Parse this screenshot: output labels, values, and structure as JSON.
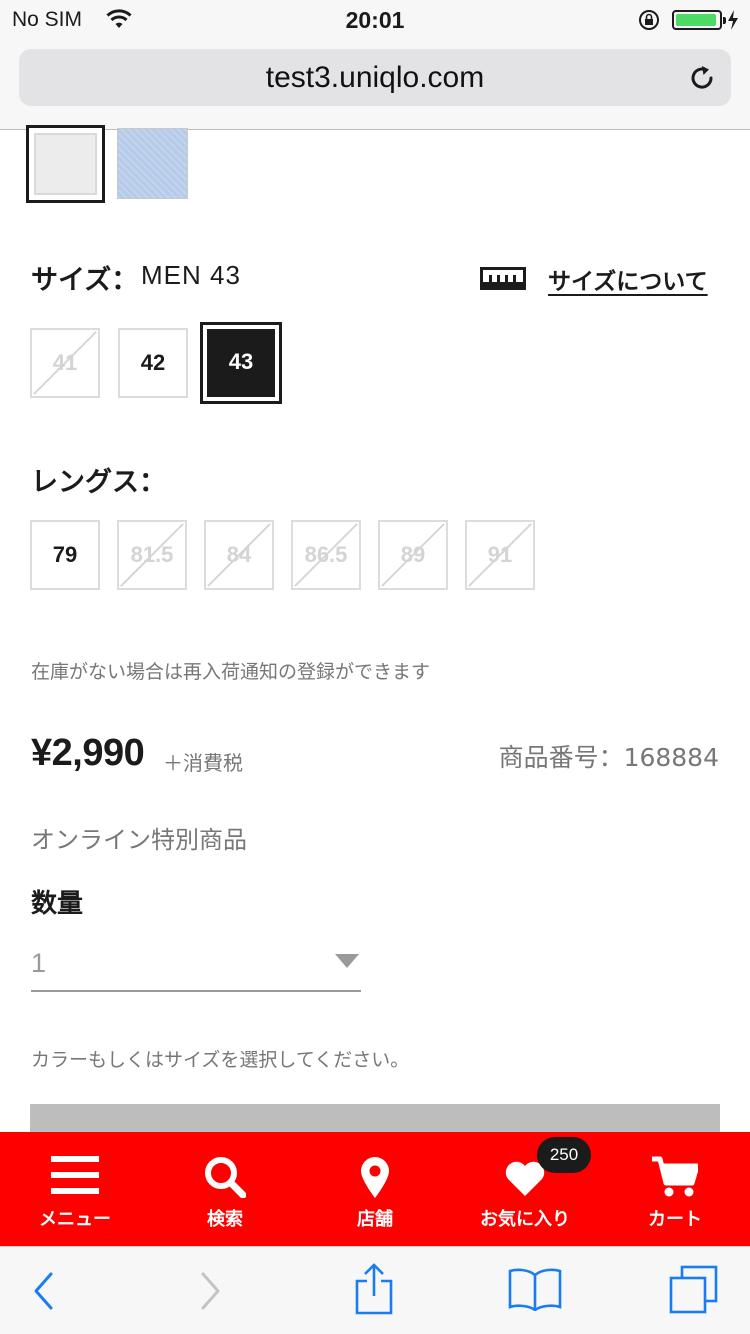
{
  "status_bar": {
    "carrier": "No SIM",
    "time": "20:01"
  },
  "browser": {
    "url": "test3.uniqlo.com"
  },
  "product": {
    "colors": [
      "white",
      "light-blue"
    ],
    "size_label": "サイズ：",
    "size_value": "MEN  43",
    "size_guide_link": "サイズについて",
    "sizes": [
      {
        "label": "41",
        "state": "disabled"
      },
      {
        "label": "42",
        "state": "available"
      },
      {
        "label": "43",
        "state": "selected"
      }
    ],
    "length_label": "レングス：",
    "lengths": [
      {
        "label": "79",
        "state": "available"
      },
      {
        "label": "81.5",
        "state": "disabled"
      },
      {
        "label": "84",
        "state": "disabled"
      },
      {
        "label": "86.5",
        "state": "disabled"
      },
      {
        "label": "89",
        "state": "disabled"
      },
      {
        "label": "91",
        "state": "disabled"
      }
    ],
    "restock_note": "在庫がない場合は再入荷通知の登録ができます",
    "price": "¥2,990",
    "tax_note": "＋消費税",
    "product_number": "商品番号：168884",
    "online_only": "オンライン特別商品",
    "quantity_label": "数量",
    "quantity_value": "1",
    "select_note": "カラーもしくはサイズを選択してください。"
  },
  "bottom_nav": {
    "items": [
      {
        "label": "メニュー",
        "icon": "menu-icon"
      },
      {
        "label": "検索",
        "icon": "search-icon"
      },
      {
        "label": "店舗",
        "icon": "location-pin-icon"
      },
      {
        "label": "お気に入り",
        "icon": "heart-icon"
      },
      {
        "label": "カート",
        "icon": "cart-icon"
      }
    ],
    "favorites_count": "250",
    "accent_color": "#ff0000"
  },
  "safari_toolbar": {
    "icons": [
      "back-icon",
      "forward-icon",
      "share-icon",
      "bookmarks-icon",
      "tabs-icon"
    ]
  }
}
